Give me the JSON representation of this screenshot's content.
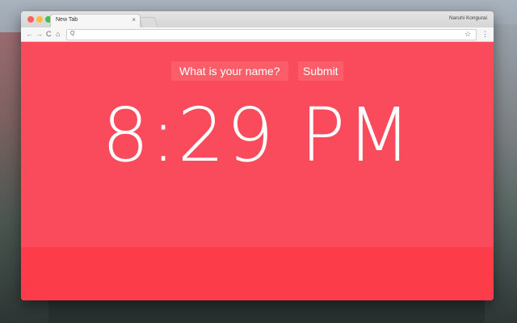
{
  "browser": {
    "tab_title": "New Tab",
    "tab_close": "×",
    "profile_name": "Naruhi Kongurai",
    "address": ""
  },
  "icons": {
    "back": "←",
    "forward": "→",
    "reload": "C",
    "home": "⌂",
    "search": "Q",
    "star": "☆",
    "menu": "⋮"
  },
  "colors": {
    "page_bg": "#fa4b5c",
    "footer_band": "#fc3c48",
    "pill_bg": "#fb5e69"
  },
  "page": {
    "name_prompt": "What is your name?",
    "submit_label": "Submit",
    "time": "8:29 PM"
  }
}
